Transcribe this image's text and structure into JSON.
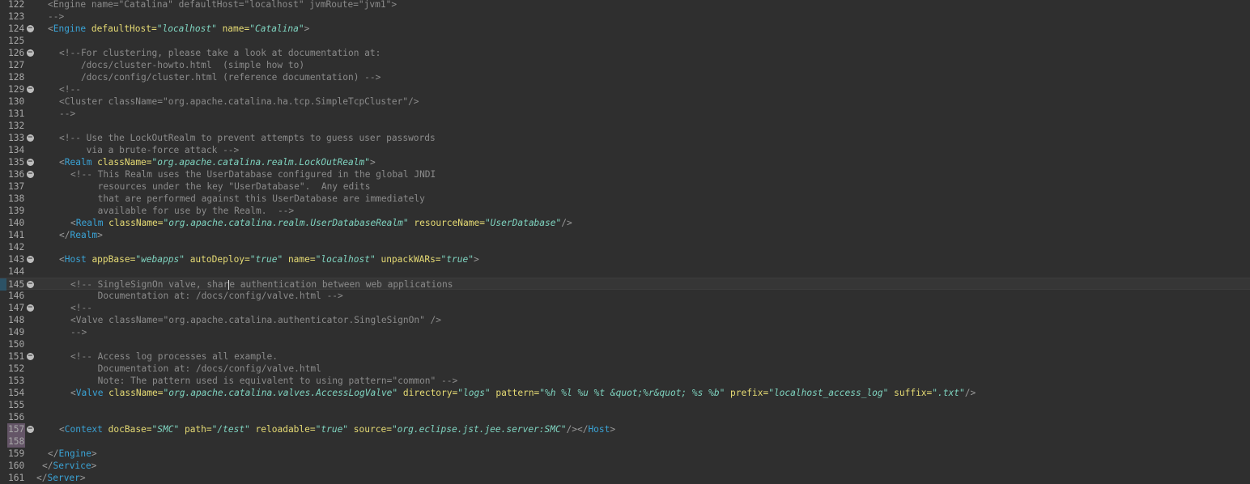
{
  "editor": {
    "lines": [
      {
        "n": "122",
        "fold": false,
        "ind": 2,
        "parts": [
          [
            "c",
            "<Engine name=\"Catalina\" defaultHost=\"localhost\" jvmRoute=\"jvm1\">"
          ]
        ]
      },
      {
        "n": "123",
        "fold": false,
        "ind": 2,
        "parts": [
          [
            "c",
            "-->"
          ]
        ]
      },
      {
        "n": "124",
        "fold": true,
        "ind": 2,
        "parts": [
          [
            "p",
            "<"
          ],
          [
            "t",
            "Engine"
          ],
          [
            "a",
            " defaultHost="
          ],
          [
            "v",
            "\"localhost\""
          ],
          [
            "a",
            " name="
          ],
          [
            "v",
            "\"Catalina\""
          ],
          [
            "p",
            ">"
          ]
        ]
      },
      {
        "n": "125",
        "fold": false,
        "ind": 0,
        "parts": []
      },
      {
        "n": "126",
        "fold": true,
        "ind": 4,
        "parts": [
          [
            "c",
            "<!--For clustering, please take a look at documentation at:"
          ]
        ]
      },
      {
        "n": "127",
        "fold": false,
        "ind": 4,
        "parts": [
          [
            "c",
            "    /docs/cluster-howto.html  (simple how to)"
          ]
        ]
      },
      {
        "n": "128",
        "fold": false,
        "ind": 4,
        "parts": [
          [
            "c",
            "    /docs/config/cluster.html (reference documentation) -->"
          ]
        ]
      },
      {
        "n": "129",
        "fold": true,
        "ind": 4,
        "parts": [
          [
            "c",
            "<!--"
          ]
        ]
      },
      {
        "n": "130",
        "fold": false,
        "ind": 4,
        "parts": [
          [
            "c",
            "<Cluster className=\"org.apache.catalina.ha.tcp.SimpleTcpCluster\"/>"
          ]
        ]
      },
      {
        "n": "131",
        "fold": false,
        "ind": 4,
        "parts": [
          [
            "c",
            "-->"
          ]
        ]
      },
      {
        "n": "132",
        "fold": false,
        "ind": 0,
        "parts": []
      },
      {
        "n": "133",
        "fold": true,
        "ind": 4,
        "parts": [
          [
            "c",
            "<!-- Use the LockOutRealm to prevent attempts to guess user passwords"
          ]
        ]
      },
      {
        "n": "134",
        "fold": false,
        "ind": 4,
        "parts": [
          [
            "c",
            "     via a brute-force attack -->"
          ]
        ]
      },
      {
        "n": "135",
        "fold": true,
        "ind": 4,
        "parts": [
          [
            "p",
            "<"
          ],
          [
            "t",
            "Realm"
          ],
          [
            "a",
            " className="
          ],
          [
            "v",
            "\"org.apache.catalina.realm.LockOutRealm\""
          ],
          [
            "p",
            ">"
          ]
        ]
      },
      {
        "n": "136",
        "fold": true,
        "ind": 6,
        "parts": [
          [
            "c",
            "<!-- This Realm uses the UserDatabase configured in the global JNDI"
          ]
        ]
      },
      {
        "n": "137",
        "fold": false,
        "ind": 6,
        "parts": [
          [
            "c",
            "     resources under the key \"UserDatabase\".  Any edits"
          ]
        ]
      },
      {
        "n": "138",
        "fold": false,
        "ind": 6,
        "parts": [
          [
            "c",
            "     that are performed against this UserDatabase are immediately"
          ]
        ]
      },
      {
        "n": "139",
        "fold": false,
        "ind": 6,
        "parts": [
          [
            "c",
            "     available for use by the Realm.  -->"
          ]
        ]
      },
      {
        "n": "140",
        "fold": false,
        "ind": 6,
        "parts": [
          [
            "p",
            "<"
          ],
          [
            "t",
            "Realm"
          ],
          [
            "a",
            " className="
          ],
          [
            "v",
            "\"org.apache.catalina.realm.UserDatabaseRealm\""
          ],
          [
            "a",
            " resourceName="
          ],
          [
            "v",
            "\"UserDatabase\""
          ],
          [
            "p",
            "/>"
          ]
        ]
      },
      {
        "n": "141",
        "fold": false,
        "ind": 4,
        "parts": [
          [
            "p",
            "</"
          ],
          [
            "t",
            "Realm"
          ],
          [
            "p",
            ">"
          ]
        ]
      },
      {
        "n": "142",
        "fold": false,
        "ind": 0,
        "parts": []
      },
      {
        "n": "143",
        "fold": true,
        "ind": 4,
        "parts": [
          [
            "p",
            "<"
          ],
          [
            "t",
            "Host"
          ],
          [
            "a",
            " appBase="
          ],
          [
            "v",
            "\"webapps\""
          ],
          [
            "a",
            " autoDeploy="
          ],
          [
            "v",
            "\"true\""
          ],
          [
            "a",
            " name="
          ],
          [
            "v",
            "\"localhost\""
          ],
          [
            "a",
            " unpackWARs="
          ],
          [
            "v",
            "\"true\""
          ],
          [
            "p",
            ">"
          ]
        ]
      },
      {
        "n": "144",
        "fold": false,
        "ind": 0,
        "parts": []
      },
      {
        "n": "145",
        "fold": true,
        "ind": 6,
        "current": true,
        "marker": true,
        "parts": [
          [
            "c",
            "<!-- SingleSignOn valve, shar"
          ],
          [
            "caret",
            ""
          ],
          [
            "c",
            "e authentication between web applications"
          ]
        ]
      },
      {
        "n": "146",
        "fold": false,
        "ind": 6,
        "parts": [
          [
            "c",
            "     Documentation at: /docs/config/valve.html -->"
          ]
        ]
      },
      {
        "n": "147",
        "fold": true,
        "ind": 6,
        "parts": [
          [
            "c",
            "<!--"
          ]
        ]
      },
      {
        "n": "148",
        "fold": false,
        "ind": 6,
        "parts": [
          [
            "c",
            "<Valve className=\"org.apache.catalina.authenticator.SingleSignOn\" />"
          ]
        ]
      },
      {
        "n": "149",
        "fold": false,
        "ind": 6,
        "parts": [
          [
            "c",
            "-->"
          ]
        ]
      },
      {
        "n": "150",
        "fold": false,
        "ind": 0,
        "parts": []
      },
      {
        "n": "151",
        "fold": true,
        "ind": 6,
        "parts": [
          [
            "c",
            "<!-- Access log processes all example."
          ]
        ]
      },
      {
        "n": "152",
        "fold": false,
        "ind": 6,
        "parts": [
          [
            "c",
            "     Documentation at: /docs/config/valve.html"
          ]
        ]
      },
      {
        "n": "153",
        "fold": false,
        "ind": 6,
        "parts": [
          [
            "c",
            "     Note: The pattern used is equivalent to using pattern=\"common\" -->"
          ]
        ]
      },
      {
        "n": "154",
        "fold": false,
        "ind": 6,
        "parts": [
          [
            "p",
            "<"
          ],
          [
            "t",
            "Valve"
          ],
          [
            "a",
            " className="
          ],
          [
            "v",
            "\"org.apache.catalina.valves.AccessLogValve\""
          ],
          [
            "a",
            " directory="
          ],
          [
            "v",
            "\"logs\""
          ],
          [
            "a",
            " pattern="
          ],
          [
            "v",
            "\"%h %l %u %t &quot;%r&quot; %s %b\""
          ],
          [
            "a",
            " prefix="
          ],
          [
            "v",
            "\"localhost_access_log\""
          ],
          [
            "a",
            " suffix="
          ],
          [
            "v",
            "\".txt\""
          ],
          [
            "p",
            "/>"
          ]
        ]
      },
      {
        "n": "155",
        "fold": false,
        "ind": 0,
        "parts": []
      },
      {
        "n": "156",
        "fold": false,
        "ind": 0,
        "parts": []
      },
      {
        "n": "157",
        "fold": true,
        "ind": 4,
        "hl": true,
        "parts": [
          [
            "p",
            "<"
          ],
          [
            "t",
            "Context"
          ],
          [
            "a",
            " docBase="
          ],
          [
            "v",
            "\"SMC\""
          ],
          [
            "a",
            " path="
          ],
          [
            "v",
            "\"/test\""
          ],
          [
            "a",
            " reloadable="
          ],
          [
            "v",
            "\"true\""
          ],
          [
            "a",
            " source="
          ],
          [
            "v",
            "\"org.eclipse.jst.jee.server:SMC\""
          ],
          [
            "p",
            "/></"
          ],
          [
            "t",
            "Host"
          ],
          [
            "p",
            ">"
          ]
        ]
      },
      {
        "n": "158",
        "fold": false,
        "ind": 0,
        "hl": true,
        "parts": []
      },
      {
        "n": "159",
        "fold": false,
        "ind": 2,
        "parts": [
          [
            "p",
            "</"
          ],
          [
            "t",
            "Engine"
          ],
          [
            "p",
            ">"
          ]
        ]
      },
      {
        "n": "160",
        "fold": false,
        "ind": 1,
        "parts": [
          [
            "p",
            "</"
          ],
          [
            "t",
            "Service"
          ],
          [
            "p",
            ">"
          ]
        ]
      },
      {
        "n": "161",
        "fold": false,
        "ind": 0,
        "parts": [
          [
            "p",
            "</"
          ],
          [
            "t",
            "Server"
          ],
          [
            "p",
            ">"
          ]
        ]
      }
    ]
  }
}
